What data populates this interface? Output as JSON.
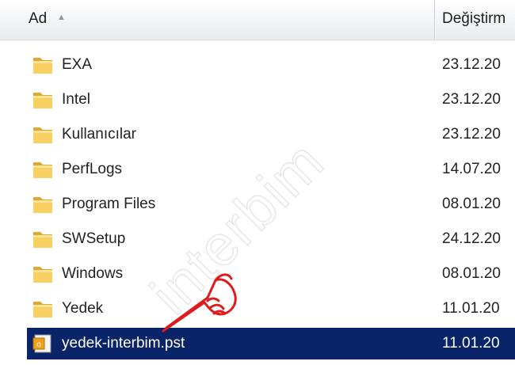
{
  "columns": {
    "name": "Ad",
    "modified": "Değiştirm"
  },
  "icons": {
    "sort": "sort-up-icon",
    "folder": "folder-icon",
    "pst": "outlook-pst-icon",
    "pointer": "pointing-hand-icon"
  },
  "colors": {
    "selection": "#0a246a",
    "folder": "#f2c14e",
    "pointer": "#e01b1b"
  },
  "files": [
    {
      "name": "EXA",
      "date": "23.12.20",
      "type": "folder"
    },
    {
      "name": "Intel",
      "date": "23.12.20",
      "type": "folder"
    },
    {
      "name": "Kullanıcılar",
      "date": "23.12.20",
      "type": "folder"
    },
    {
      "name": "PerfLogs",
      "date": "14.07.20",
      "type": "folder"
    },
    {
      "name": "Program Files",
      "date": "08.01.20",
      "type": "folder"
    },
    {
      "name": "SWSetup",
      "date": "24.12.20",
      "type": "folder"
    },
    {
      "name": "Windows",
      "date": "08.01.20",
      "type": "folder"
    },
    {
      "name": "Yedek",
      "date": "11.01.20",
      "type": "folder"
    },
    {
      "name": "yedek-interbim.pst",
      "date": "11.01.20",
      "type": "pst",
      "selected": true
    }
  ],
  "watermark": "interbim"
}
